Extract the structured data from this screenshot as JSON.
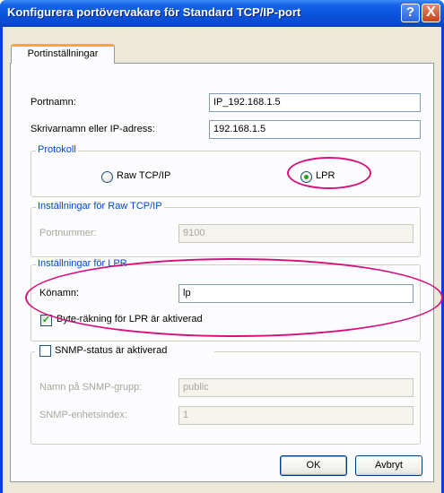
{
  "window": {
    "title": "Konfigurera portövervakare för Standard TCP/IP-port",
    "help_label": "?",
    "close_label": "X"
  },
  "tab": {
    "label": "Portinställningar"
  },
  "fields": {
    "portname": {
      "label": "Portnamn:",
      "value": "IP_192.168.1.5"
    },
    "printer": {
      "label": "Skrivarnamn eller IP-adress:",
      "value": "192.168.1.5"
    }
  },
  "protocol": {
    "title": "Protokoll",
    "options": [
      {
        "label": "Raw TCP/IP",
        "selected": false
      },
      {
        "label": "LPR",
        "selected": true
      }
    ]
  },
  "raw_settings": {
    "title": "Inställningar för Raw TCP/IP",
    "port_label": "Portnummer:",
    "port_value": "9100",
    "enabled": false
  },
  "lpr_settings": {
    "title": "Inställningar för LPR",
    "queue_label": "Könamn:",
    "queue_value": "lp",
    "byte_count_label": "Byte-räkning för LPR är aktiverad",
    "byte_count_checked": true
  },
  "snmp": {
    "label": "SNMP-status är aktiverad",
    "checked": false,
    "community_label": "Namn på SNMP-grupp:",
    "community_value": "public",
    "index_label": "SNMP-enhetsindex:",
    "index_value": "1",
    "enabled": false
  },
  "buttons": {
    "ok": "OK",
    "cancel": "Avbryt"
  },
  "annotation_color": "#d4127c"
}
